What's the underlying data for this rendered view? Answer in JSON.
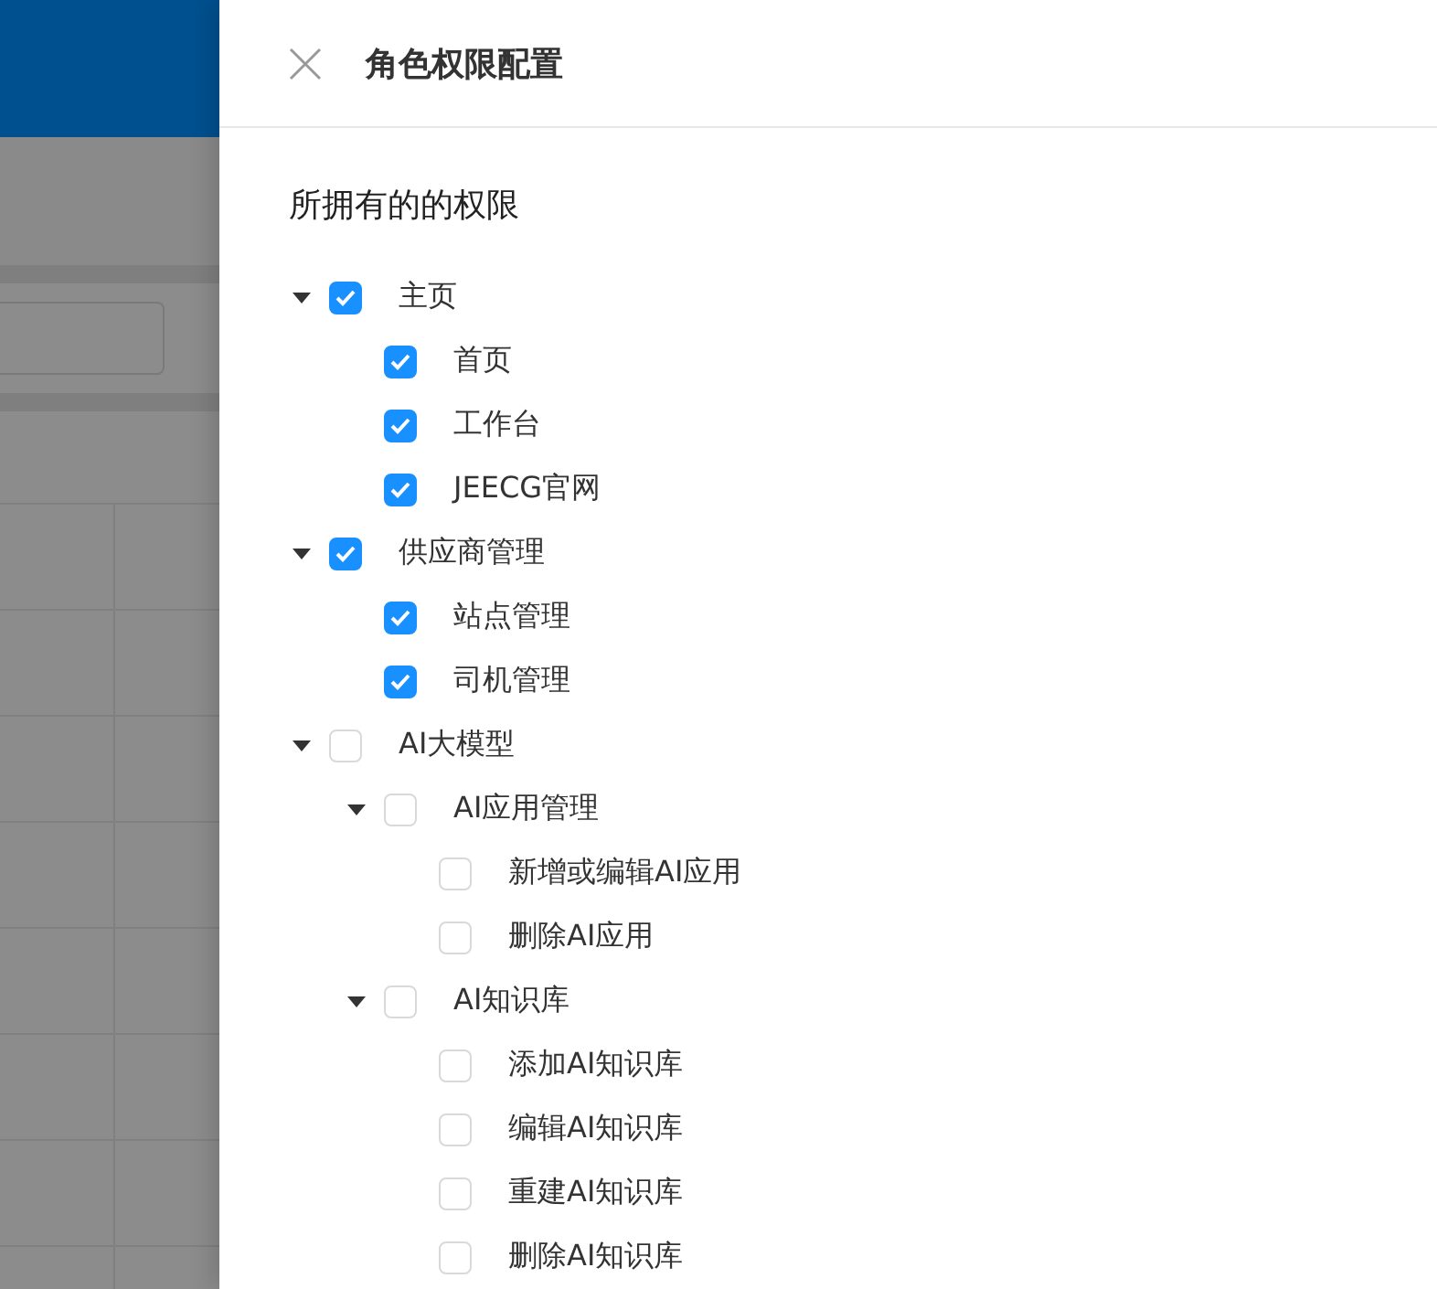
{
  "drawer": {
    "title": "角色权限配置",
    "section_title": "所拥有的的权限"
  },
  "tree": [
    {
      "label": "主页",
      "checked": true,
      "expanded": true,
      "children": [
        {
          "label": "首页",
          "checked": true
        },
        {
          "label": "工作台",
          "checked": true
        },
        {
          "label": "JEECG官网",
          "checked": true
        }
      ]
    },
    {
      "label": "供应商管理",
      "checked": true,
      "expanded": true,
      "children": [
        {
          "label": "站点管理",
          "checked": true
        },
        {
          "label": "司机管理",
          "checked": true
        }
      ]
    },
    {
      "label": "AI大模型",
      "checked": false,
      "expanded": true,
      "children": [
        {
          "label": "AI应用管理",
          "checked": false,
          "expanded": true,
          "children": [
            {
              "label": "新增或编辑AI应用",
              "checked": false
            },
            {
              "label": "删除AI应用",
              "checked": false
            }
          ]
        },
        {
          "label": "AI知识库",
          "checked": false,
          "expanded": true,
          "children": [
            {
              "label": "添加AI知识库",
              "checked": false
            },
            {
              "label": "编辑AI知识库",
              "checked": false
            },
            {
              "label": "重建AI知识库",
              "checked": false
            },
            {
              "label": "删除AI知识库",
              "checked": false
            }
          ]
        }
      ]
    }
  ]
}
